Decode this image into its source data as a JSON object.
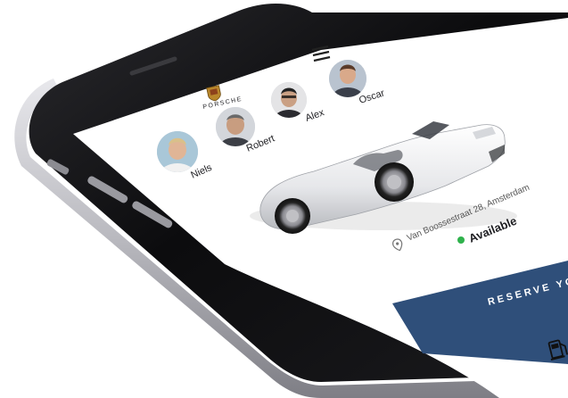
{
  "brand": {
    "logo_text": "PORSCHE",
    "crest_icon": "porsche-crest-icon"
  },
  "menu_icon": "hamburger-menu-icon",
  "drivers": [
    {
      "name": "Oscar",
      "avatar_icon": "person-avatar-icon"
    },
    {
      "name": "Alex",
      "avatar_icon": "person-avatar-icon"
    },
    {
      "name": "Robert",
      "avatar_icon": "person-avatar-icon"
    },
    {
      "name": "Niels",
      "avatar_icon": "person-avatar-icon"
    }
  ],
  "car": {
    "image_icon": "white-convertible-car-icon",
    "location_icon": "location-pin-icon",
    "address": "Van Boossestraat 28, Amsterdam",
    "status": "Available",
    "status_color": "#2fb24c"
  },
  "reserve_button": {
    "label": "RESERVE YOU",
    "background": "#2f4f7a"
  },
  "fuel_icon": "fuel-pump-icon",
  "colors": {
    "phone_body": "#0e0e10",
    "phone_bezel": "#d7d7db",
    "screen": "#ffffff"
  }
}
